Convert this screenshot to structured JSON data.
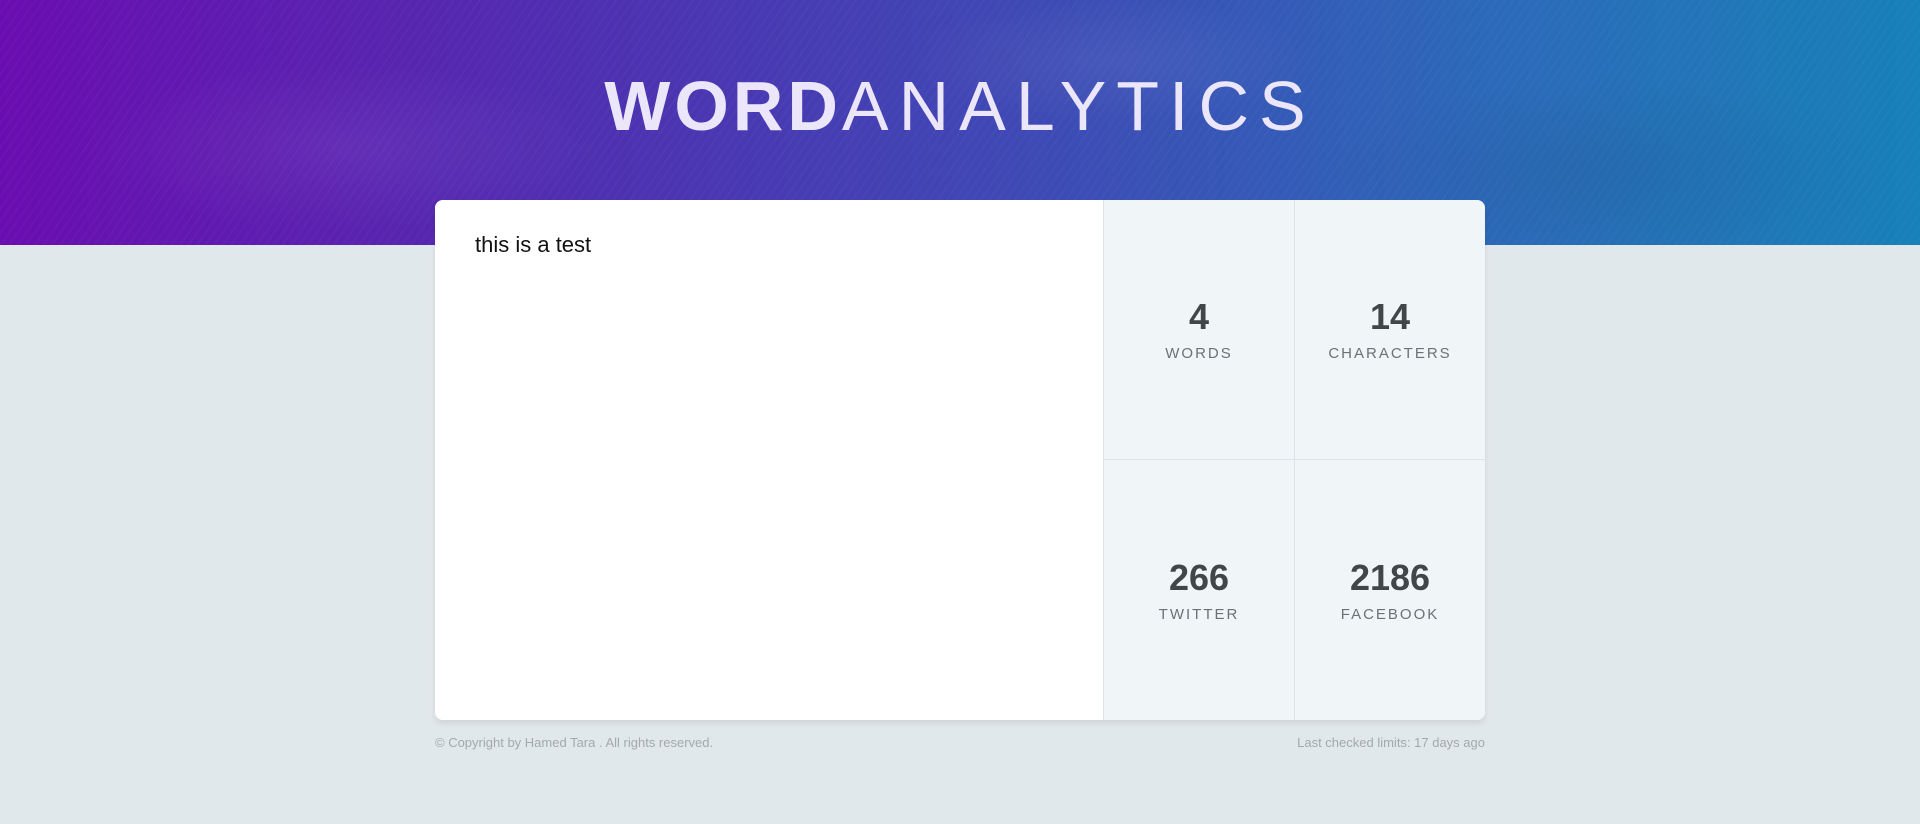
{
  "header": {
    "logo_bold": "WORD",
    "logo_light": "ANALYTICS"
  },
  "editor": {
    "value": "this is a test",
    "placeholder": ""
  },
  "stats": {
    "words": {
      "number": "4",
      "label": "WORDS"
    },
    "characters": {
      "number": "14",
      "label": "CHARACTERS"
    },
    "twitter": {
      "number": "266",
      "label": "TWITTER"
    },
    "facebook": {
      "number": "2186",
      "label": "FACEBOOK"
    }
  },
  "footer": {
    "copyright": "© Copyright by Hamed Tara . All rights reserved.",
    "last_checked": "Last checked limits: 17 days ago"
  },
  "colors": {
    "hero_start": "#6a0db0",
    "hero_end": "#1780b8",
    "page_background": "#e1e8eb",
    "stats_background": "#f0f5f7"
  }
}
